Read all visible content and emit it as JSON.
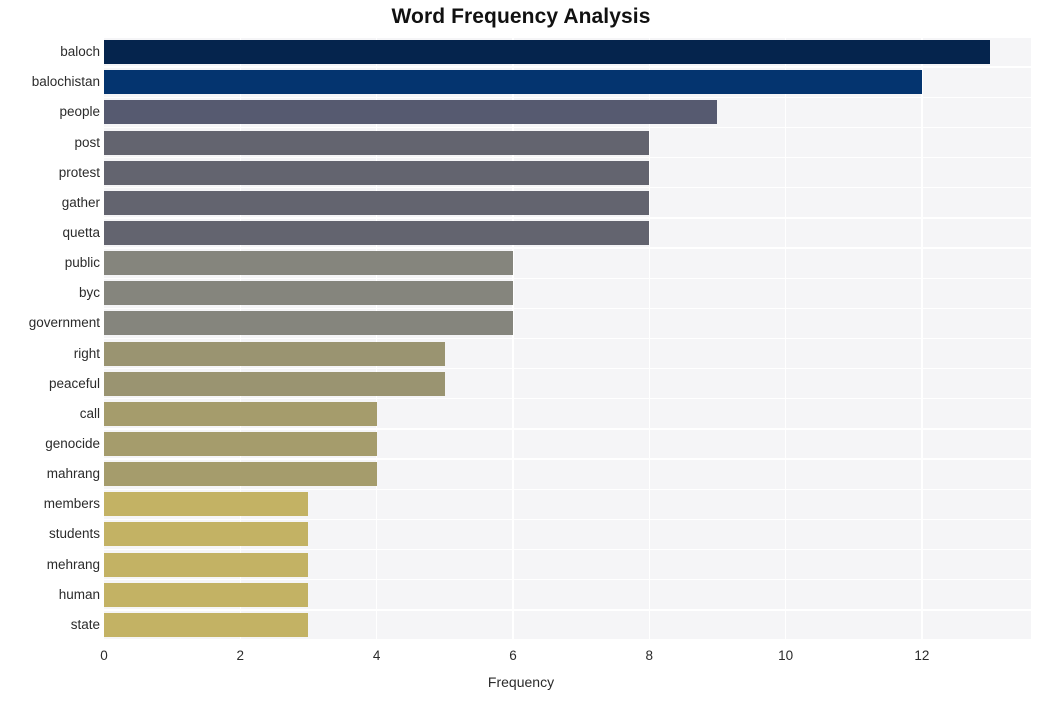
{
  "chart_data": {
    "type": "bar",
    "orientation": "horizontal",
    "title": "Word Frequency Analysis",
    "xlabel": "Frequency",
    "ylabel": "",
    "xlim": [
      0,
      13.6
    ],
    "ylim": [
      0,
      20
    ],
    "grid": true,
    "legend": null,
    "xticks": [
      0,
      2,
      4,
      6,
      8,
      10,
      12
    ],
    "xtick_labels": [
      "0",
      "2",
      "4",
      "6",
      "8",
      "10",
      "12"
    ],
    "categories": [
      "baloch",
      "balochistan",
      "people",
      "post",
      "protest",
      "gather",
      "quetta",
      "public",
      "byc",
      "government",
      "right",
      "peaceful",
      "call",
      "genocide",
      "mahrang",
      "members",
      "students",
      "mehrang",
      "human",
      "state"
    ],
    "values": [
      13,
      12,
      9,
      8,
      8,
      8,
      8,
      6,
      6,
      6,
      5,
      5,
      4,
      4,
      4,
      3,
      3,
      3,
      3,
      3
    ],
    "bar_colors": [
      "#05244d",
      "#04346f",
      "#565a70",
      "#63646f",
      "#63646f",
      "#63646f",
      "#63646f",
      "#85857d",
      "#85857d",
      "#85857d",
      "#9a9471",
      "#9a9471",
      "#a59c6c",
      "#a59c6c",
      "#a59c6c",
      "#c3b264",
      "#c3b264",
      "#c3b264",
      "#c3b264",
      "#c3b264"
    ]
  },
  "style": {
    "plot_background": "#f5f5f7",
    "gridline_color": "#ffffff",
    "page_background": "#ffffff",
    "tick_text_color": "#2b2b2b",
    "title_color": "#111111"
  }
}
